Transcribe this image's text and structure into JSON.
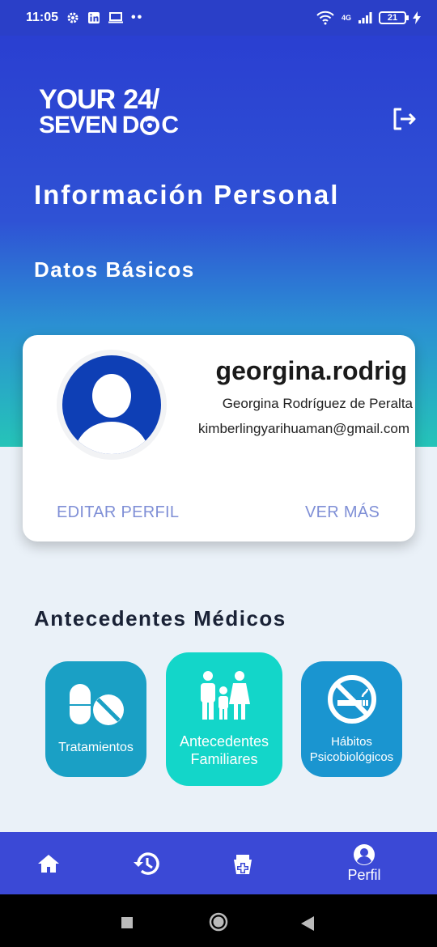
{
  "status_bar": {
    "time": "11:05",
    "network": "4G",
    "battery": "21"
  },
  "logo": {
    "line1_word": "YOUR",
    "line1_number": "24/",
    "line2_word": "SEVEN",
    "line2_d": "D",
    "line2_c": "C"
  },
  "header": {
    "title": "Información Personal",
    "section": "Datos Básicos"
  },
  "profile": {
    "username": "georgina.rodrig",
    "full_name": "Georgina Rodríguez de Peralta",
    "email": "kimberlingyarihuaman@gmail.com",
    "edit_label": "EDITAR PERFIL",
    "more_label": "VER MÁS"
  },
  "medical": {
    "title": "Antecedentes Médicos",
    "tiles": [
      {
        "label": "Tratamientos",
        "icon": "pills-icon",
        "color": "#1aa0c5"
      },
      {
        "label": "Antecedentes Familiares",
        "icon": "family-icon",
        "color": "#13d6c9"
      },
      {
        "label": "Hábitos Psicobiológicos",
        "icon": "no-smoking-icon",
        "color": "#1a95d0"
      }
    ]
  },
  "bottom_nav": {
    "items": [
      {
        "icon": "home-icon",
        "label": ""
      },
      {
        "icon": "history-icon",
        "label": ""
      },
      {
        "icon": "medical-kit-icon",
        "label": ""
      },
      {
        "icon": "profile-icon",
        "label": "Perfil"
      }
    ]
  },
  "colors": {
    "header_top": "#2a3fd1",
    "header_bottom": "#25c4b8",
    "accent_link": "#7f8fd6",
    "nav_bg": "#3b49d6",
    "avatar_bg": "#0e3fb5"
  }
}
